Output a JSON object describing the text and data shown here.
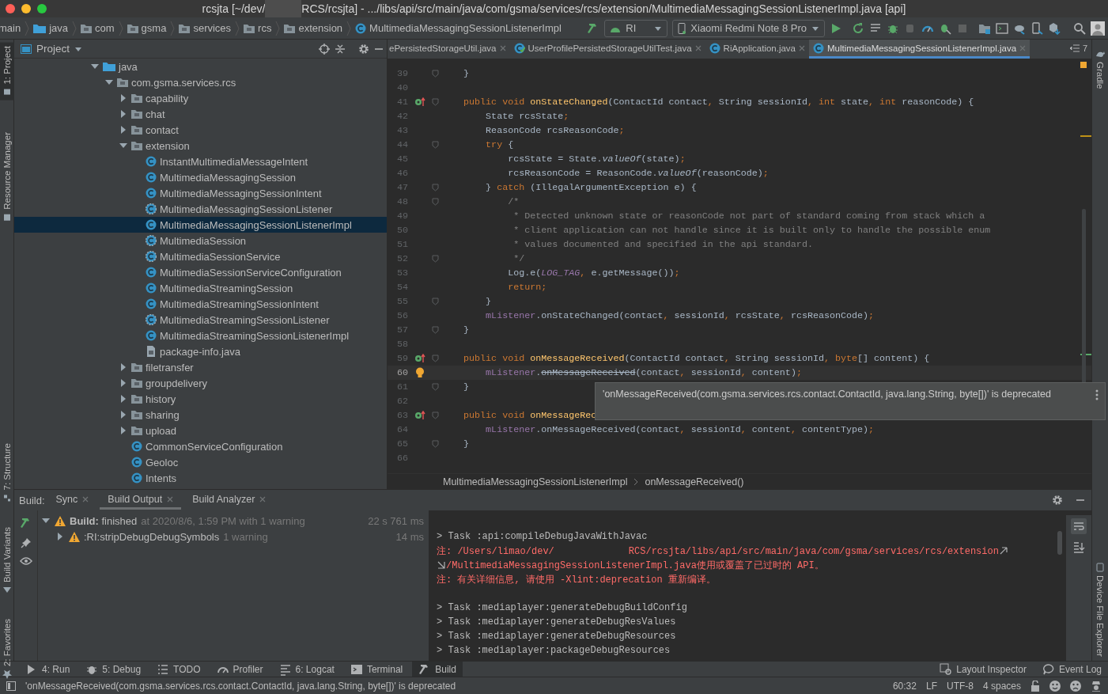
{
  "window": {
    "title_parts": [
      "rcsjta [~/dev/",
      "RCS/rcsjta] - .../libs/api/src/main/java/com/gsma/services/rcs/extension/MultimediaMessagingSessionListenerImpl.java [api]"
    ]
  },
  "breadcrumbs": [
    {
      "label": "main",
      "kind": "plain"
    },
    {
      "label": "java",
      "kind": "source"
    },
    {
      "label": "com",
      "kind": "package"
    },
    {
      "label": "gsma",
      "kind": "package"
    },
    {
      "label": "services",
      "kind": "package"
    },
    {
      "label": "rcs",
      "kind": "package"
    },
    {
      "label": "extension",
      "kind": "package"
    },
    {
      "label": "MultimediaMessagingSessionListenerImpl",
      "kind": "class"
    }
  ],
  "toolbar": {
    "run_config": "RI",
    "device": "Xiaomi Redmi Note 8 Pro"
  },
  "left_tool_tabs": [
    {
      "label": "1: Project",
      "selected": true
    },
    {
      "label": "Resource Manager",
      "selected": false
    },
    {
      "label": "7: Structure",
      "selected": false
    },
    {
      "label": "Build Variants",
      "selected": false
    },
    {
      "label": "2: Favorites",
      "selected": false
    }
  ],
  "right_tool_tabs": [
    {
      "label": "Gradle"
    },
    {
      "label": "Device File Explorer"
    }
  ],
  "project": {
    "title": "Project",
    "tree": [
      {
        "label": "java",
        "kind": "source",
        "expanded": true,
        "selected": false,
        "children": [
          {
            "label": "com.gsma.services.rcs",
            "kind": "folder",
            "expanded": true,
            "selected": false,
            "children": [
              {
                "label": "capability",
                "kind": "folder",
                "expanded": false,
                "selected": false
              },
              {
                "label": "chat",
                "kind": "folder",
                "expanded": false,
                "selected": false
              },
              {
                "label": "contact",
                "kind": "folder",
                "expanded": false,
                "selected": false
              },
              {
                "label": "extension",
                "kind": "folder",
                "expanded": true,
                "selected": false,
                "children": [
                  {
                    "label": "InstantMultimediaMessageIntent",
                    "kind": "class",
                    "selected": false
                  },
                  {
                    "label": "MultimediaMessagingSession",
                    "kind": "class",
                    "selected": false
                  },
                  {
                    "label": "MultimediaMessagingSessionIntent",
                    "kind": "class",
                    "selected": false
                  },
                  {
                    "label": "MultimediaMessagingSessionListener",
                    "kind": "abstract",
                    "selected": false
                  },
                  {
                    "label": "MultimediaMessagingSessionListenerImpl",
                    "kind": "class",
                    "selected": true
                  },
                  {
                    "label": "MultimediaSession",
                    "kind": "abstract",
                    "selected": false
                  },
                  {
                    "label": "MultimediaSessionService",
                    "kind": "abstract",
                    "selected": false
                  },
                  {
                    "label": "MultimediaSessionServiceConfiguration",
                    "kind": "class",
                    "selected": false
                  },
                  {
                    "label": "MultimediaStreamingSession",
                    "kind": "class",
                    "selected": false
                  },
                  {
                    "label": "MultimediaStreamingSessionIntent",
                    "kind": "class",
                    "selected": false
                  },
                  {
                    "label": "MultimediaStreamingSessionListener",
                    "kind": "abstract",
                    "selected": false
                  },
                  {
                    "label": "MultimediaStreamingSessionListenerImpl",
                    "kind": "class",
                    "selected": false
                  },
                  {
                    "label": "package-info.java",
                    "kind": "file",
                    "selected": false
                  }
                ]
              },
              {
                "label": "filetransfer",
                "kind": "folder",
                "expanded": false,
                "selected": false
              },
              {
                "label": "groupdelivery",
                "kind": "folder",
                "expanded": false,
                "selected": false
              },
              {
                "label": "history",
                "kind": "folder",
                "expanded": false,
                "selected": false
              },
              {
                "label": "sharing",
                "kind": "folder",
                "expanded": false,
                "selected": false
              },
              {
                "label": "upload",
                "kind": "folder",
                "expanded": false,
                "selected": false
              },
              {
                "label": "CommonServiceConfiguration",
                "kind": "class",
                "selected": false
              },
              {
                "label": "Geoloc",
                "kind": "class",
                "selected": false
              },
              {
                "label": "Intents",
                "kind": "class",
                "selected": false
              }
            ]
          }
        ]
      }
    ]
  },
  "editor_tabs": [
    {
      "label": "ePersistedStorageUtil.java",
      "kind": "cut",
      "selected": false
    },
    {
      "label": "UserProfilePersistedStorageUtilTest.java",
      "kind": "test",
      "selected": false
    },
    {
      "label": "RiApplication.java",
      "kind": "class",
      "selected": false
    },
    {
      "label": "MultimediaMessagingSessionListenerImpl.java",
      "kind": "class",
      "selected": true
    }
  ],
  "tab_overflow": "7",
  "code": [
    {
      "num": "39",
      "fold": true,
      "override_marker": false,
      "bulb": false,
      "current": false,
      "tokens": [
        {
          "kind": "plain",
          "text": "    }"
        }
      ]
    },
    {
      "num": "40",
      "fold": false,
      "override_marker": false,
      "bulb": false,
      "current": false
    },
    {
      "num": "41",
      "fold": true,
      "override_marker": true,
      "bulb": false,
      "current": false,
      "tokens": [
        {
          "kind": "keyword",
          "text": "    public void "
        },
        {
          "kind": "declaration",
          "text": "onStateChanged"
        },
        {
          "kind": "plain",
          "text": "(ContactId contact"
        },
        {
          "kind": "keyword",
          "text": ", "
        },
        {
          "kind": "plain",
          "text": "String sessionId"
        },
        {
          "kind": "keyword",
          "text": ", int "
        },
        {
          "kind": "plain",
          "text": "state"
        },
        {
          "kind": "keyword",
          "text": ", int "
        },
        {
          "kind": "plain",
          "text": "reasonCode) {"
        }
      ]
    },
    {
      "num": "42",
      "fold": false,
      "override_marker": false,
      "bulb": false,
      "current": false,
      "tokens": [
        {
          "kind": "plain",
          "text": "        State rcsState"
        },
        {
          "kind": "keyword",
          "text": ";"
        }
      ]
    },
    {
      "num": "43",
      "fold": false,
      "override_marker": false,
      "bulb": false,
      "current": false,
      "tokens": [
        {
          "kind": "plain",
          "text": "        ReasonCode rcsReasonCode"
        },
        {
          "kind": "keyword",
          "text": ";"
        }
      ]
    },
    {
      "num": "44",
      "fold": true,
      "override_marker": false,
      "bulb": false,
      "current": false,
      "tokens": [
        {
          "kind": "keyword",
          "text": "        try "
        },
        {
          "kind": "plain",
          "text": "{"
        }
      ]
    },
    {
      "num": "45",
      "fold": false,
      "override_marker": false,
      "bulb": false,
      "current": false,
      "tokens": [
        {
          "kind": "plain",
          "text": "            rcsState = State."
        },
        {
          "kind": "static_call",
          "text": "valueOf"
        },
        {
          "kind": "plain",
          "text": "(state)"
        },
        {
          "kind": "keyword",
          "text": ";"
        }
      ]
    },
    {
      "num": "46",
      "fold": false,
      "override_marker": false,
      "bulb": false,
      "current": false,
      "tokens": [
        {
          "kind": "plain",
          "text": "            rcsReasonCode = ReasonCode."
        },
        {
          "kind": "static_call",
          "text": "valueOf"
        },
        {
          "kind": "plain",
          "text": "(reasonCode)"
        },
        {
          "kind": "keyword",
          "text": ";"
        }
      ]
    },
    {
      "num": "47",
      "fold": true,
      "override_marker": false,
      "bulb": false,
      "current": false,
      "tokens": [
        {
          "kind": "plain",
          "text": "        } "
        },
        {
          "kind": "keyword",
          "text": "catch "
        },
        {
          "kind": "plain",
          "text": "(IllegalArgumentException e) {"
        }
      ]
    },
    {
      "num": "48",
      "fold": true,
      "override_marker": false,
      "bulb": false,
      "current": false,
      "tokens": [
        {
          "kind": "comment",
          "text": "            /*"
        }
      ]
    },
    {
      "num": "49",
      "fold": false,
      "override_marker": false,
      "bulb": false,
      "current": false,
      "tokens": [
        {
          "kind": "comment",
          "text": "             * Detected unknown state or reasonCode not part of standard coming from stack which a"
        }
      ]
    },
    {
      "num": "50",
      "fold": false,
      "override_marker": false,
      "bulb": false,
      "current": false,
      "tokens": [
        {
          "kind": "comment",
          "text": "             * client application can not handle since it is built only to handle the possible enum"
        }
      ]
    },
    {
      "num": "51",
      "fold": false,
      "override_marker": false,
      "bulb": false,
      "current": false,
      "tokens": [
        {
          "kind": "comment",
          "text": "             * values documented and specified in the api standard."
        }
      ]
    },
    {
      "num": "52",
      "fold": true,
      "override_marker": false,
      "bulb": false,
      "current": false,
      "tokens": [
        {
          "kind": "comment",
          "text": "             */"
        }
      ]
    },
    {
      "num": "53",
      "fold": false,
      "override_marker": false,
      "bulb": false,
      "current": false,
      "tokens": [
        {
          "kind": "plain",
          "text": "            Log.e("
        },
        {
          "kind": "static_field",
          "text": "LOG_TAG"
        },
        {
          "kind": "keyword",
          "text": ", "
        },
        {
          "kind": "plain",
          "text": "e.getMessage())"
        },
        {
          "kind": "keyword",
          "text": ";"
        }
      ]
    },
    {
      "num": "54",
      "fold": false,
      "override_marker": false,
      "bulb": false,
      "current": false,
      "tokens": [
        {
          "kind": "keyword",
          "text": "            return;"
        }
      ]
    },
    {
      "num": "55",
      "fold": true,
      "override_marker": false,
      "bulb": false,
      "current": false,
      "tokens": [
        {
          "kind": "plain",
          "text": "        }"
        }
      ]
    },
    {
      "num": "56",
      "fold": false,
      "override_marker": false,
      "bulb": false,
      "current": false,
      "tokens": [
        {
          "kind": "field",
          "text": "        mListener"
        },
        {
          "kind": "plain",
          "text": ".onStateChanged(contact"
        },
        {
          "kind": "keyword",
          "text": ", "
        },
        {
          "kind": "plain",
          "text": "sessionId"
        },
        {
          "kind": "keyword",
          "text": ", "
        },
        {
          "kind": "plain",
          "text": "rcsState"
        },
        {
          "kind": "keyword",
          "text": ", "
        },
        {
          "kind": "plain",
          "text": "rcsReasonCode)"
        },
        {
          "kind": "keyword",
          "text": ";"
        }
      ]
    },
    {
      "num": "57",
      "fold": true,
      "override_marker": false,
      "bulb": false,
      "current": false,
      "tokens": [
        {
          "kind": "plain",
          "text": "    }"
        }
      ]
    },
    {
      "num": "58",
      "fold": false,
      "override_marker": false,
      "bulb": false,
      "current": false
    },
    {
      "num": "59",
      "fold": true,
      "override_marker": true,
      "bulb": false,
      "current": false,
      "tokens": [
        {
          "kind": "keyword",
          "text": "    public void "
        },
        {
          "kind": "declaration",
          "text": "onMessageReceived"
        },
        {
          "kind": "plain",
          "text": "(ContactId contact"
        },
        {
          "kind": "keyword",
          "text": ", "
        },
        {
          "kind": "plain",
          "text": "String sessionId"
        },
        {
          "kind": "keyword",
          "text": ", byte"
        },
        {
          "kind": "plain",
          "text": "[] content) {"
        }
      ]
    },
    {
      "num": "60",
      "fold": false,
      "override_marker": false,
      "bulb": true,
      "current": true,
      "tokens": [
        {
          "kind": "field",
          "text": "        mListener"
        },
        {
          "kind": "plain",
          "text": "."
        },
        {
          "kind": "deprecated",
          "text": "onMessageReceived"
        },
        {
          "kind": "plain",
          "text": "(contact"
        },
        {
          "kind": "keyword",
          "text": ", "
        },
        {
          "kind": "plain",
          "text": "sessionId"
        },
        {
          "kind": "keyword",
          "text": ", "
        },
        {
          "kind": "plain",
          "text": "content)"
        },
        {
          "kind": "keyword",
          "text": ";"
        }
      ]
    },
    {
      "num": "61",
      "fold": true,
      "override_marker": false,
      "bulb": false,
      "current": false,
      "tokens": [
        {
          "kind": "plain",
          "text": "    }"
        }
      ]
    },
    {
      "num": "62",
      "fold": false,
      "override_marker": false,
      "bulb": false,
      "current": false
    },
    {
      "num": "63",
      "fold": true,
      "override_marker": true,
      "bulb": false,
      "current": false,
      "tokens": [
        {
          "kind": "keyword",
          "text": "    public void "
        },
        {
          "kind": "declaration",
          "text": "onMessageRec"
        }
      ]
    },
    {
      "num": "64",
      "fold": false,
      "override_marker": false,
      "bulb": false,
      "current": false,
      "tokens": [
        {
          "kind": "field",
          "text": "        mListener"
        },
        {
          "kind": "plain",
          "text": ".onMessageReceived(contact"
        },
        {
          "kind": "keyword",
          "text": ", "
        },
        {
          "kind": "plain",
          "text": "sessionId"
        },
        {
          "kind": "keyword",
          "text": ", "
        },
        {
          "kind": "plain",
          "text": "content"
        },
        {
          "kind": "keyword",
          "text": ", "
        },
        {
          "kind": "plain",
          "text": "contentType)"
        },
        {
          "kind": "keyword",
          "text": ";"
        }
      ]
    },
    {
      "num": "65",
      "fold": true,
      "override_marker": false,
      "bulb": false,
      "current": false,
      "tokens": [
        {
          "kind": "plain",
          "text": "    }"
        }
      ]
    },
    {
      "num": "66",
      "fold": false,
      "override_marker": false,
      "bulb": false,
      "current": false
    }
  ],
  "tooltip": "'onMessageReceived(com.gsma.services.rcs.contact.ContactId, java.lang.String, byte[])' is deprecated",
  "editor_breadcrumbs": [
    "MultimediaMessagingSessionListenerImpl",
    "onMessageReceived()"
  ],
  "build": {
    "label": "Build:",
    "tabs": [
      {
        "label": "Sync",
        "selected": false
      },
      {
        "label": "Build Output",
        "selected": true
      },
      {
        "label": "Build Analyzer",
        "selected": false
      }
    ],
    "tree": [
      {
        "label": "**Build:** finished",
        "detail": "at 2020/8/6, 1:59 PM with 1 warning",
        "time": "22 s 761 ms",
        "expanded": true,
        "children": [
          {
            "label": ":RI:stripDebugDebugSymbols",
            "detail": "1 warning",
            "time": "14 ms",
            "expanded": false
          }
        ]
      }
    ],
    "console": [
      {
        "kind": "blank"
      },
      {
        "kind": "normal",
        "parts": [
          "> Task :api:compileDebugJavaWithJavac"
        ]
      },
      {
        "kind": "error",
        "wrap_end": true,
        "parts": [
          "注: /Users/limao/dev/",
          "RCS/rcsjta/libs/api/src/main/java/com/gsma/services/rcs/extension"
        ]
      },
      {
        "kind": "error",
        "wrap_start": true,
        "parts": [
          "/MultimediaMessagingSessionListenerImpl.java使用或覆盖了已过时的 API。"
        ]
      },
      {
        "kind": "error",
        "parts": [
          "注: 有关详细信息, 请使用 -Xlint:deprecation 重新编译。"
        ]
      },
      {
        "kind": "blank"
      },
      {
        "kind": "normal",
        "parts": [
          "> Task :mediaplayer:generateDebugBuildConfig"
        ]
      },
      {
        "kind": "normal",
        "parts": [
          "> Task :mediaplayer:generateDebugResValues"
        ]
      },
      {
        "kind": "normal",
        "parts": [
          "> Task :mediaplayer:generateDebugResources"
        ]
      },
      {
        "kind": "normal",
        "parts": [
          "> Task :mediaplayer:packageDebugResources"
        ]
      }
    ]
  },
  "tool_windows": [
    {
      "label": "4: Run",
      "kind": "run",
      "selected": false
    },
    {
      "label": "5: Debug",
      "kind": "debug",
      "selected": false
    },
    {
      "label": "TODO",
      "kind": "todo",
      "selected": false
    },
    {
      "label": "Profiler",
      "kind": "profiler",
      "selected": false
    },
    {
      "label": "6: Logcat",
      "kind": "logcat",
      "selected": false
    },
    {
      "label": "Terminal",
      "kind": "terminal",
      "selected": false
    },
    {
      "label": "Build",
      "kind": "build",
      "selected": true
    }
  ],
  "tool_windows_right": [
    {
      "label": "Layout Inspector",
      "kind": "inspector"
    },
    {
      "label": "Event Log",
      "kind": "log"
    }
  ],
  "status_bar": {
    "message": "'onMessageReceived(com.gsma.services.rcs.contact.ContactId, java.lang.String, byte[])' is deprecated",
    "position": "60:32",
    "line_ending": "LF",
    "encoding": "UTF-8",
    "indent": "4 spaces"
  }
}
